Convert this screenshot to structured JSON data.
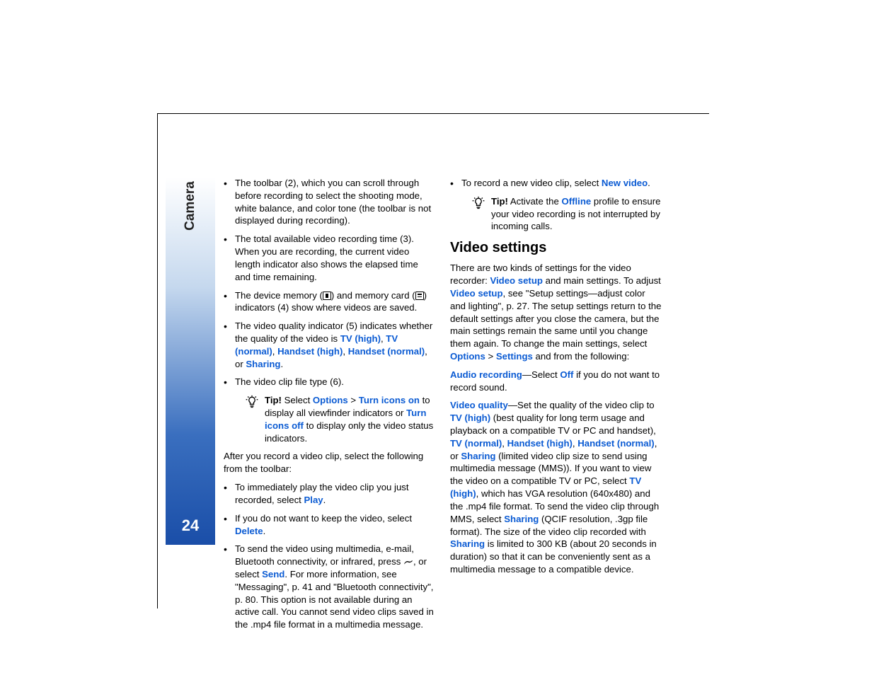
{
  "sidebar": {
    "section": "Camera",
    "page_number": "24"
  },
  "col1": {
    "bullets_top": [
      {
        "text": "The toolbar (2), which you can scroll through before recording to select the shooting mode, white balance, and color tone (the toolbar is not displayed during recording)."
      },
      {
        "text": "The total available video recording time (3). When you are recording, the current video length indicator also shows the elapsed time and time remaining."
      }
    ],
    "memory_pre": "The device memory (",
    "memory_mid": ") and memory card (",
    "memory_post": ") indicators (4) show where videos are saved.",
    "quality_pre": "The video quality indicator (5) indicates whether the quality of the video is ",
    "q_tvhigh": "TV (high)",
    "q_sep1": ", ",
    "q_tvnorm": "TV (normal)",
    "q_sep2": ", ",
    "q_hshigh": "Handset (high)",
    "q_sep3": ", ",
    "q_hsnorm": "Handset (normal)",
    "q_sep4": ", or ",
    "q_sharing": "Sharing",
    "q_end": ".",
    "filetype": "The video clip file type (6).",
    "tip1_tip": "Tip!",
    "tip1_a": " Select ",
    "tip1_options": "Options",
    "tip1_gt": " > ",
    "tip1_on": "Turn icons on",
    "tip1_b": " to display all viewfinder indicators or ",
    "tip1_off": "Turn icons off",
    "tip1_c": " to display only the video status indicators.",
    "after_record": "After you record a video clip, select the following from the toolbar:",
    "play_pre": "To immediately play the video clip you just recorded, select ",
    "play": "Play",
    "play_post": ".",
    "delete_pre": "If you do not want to keep the video, select ",
    "delete": "Delete",
    "delete_post": ".",
    "send_pre": "To send the video using multimedia, e-mail, Bluetooth connectivity, or infrared, press ",
    "send_mid": ", or select ",
    "send": "Send",
    "send_post": ". For more information, see \"Messaging\", p. 41 and \"Bluetooth connectivity\", p. 80. This option is not available during an active call. You cannot send video clips saved in the .mp4 file format in a multimedia message."
  },
  "col2": {
    "newvid_pre": "To record a new video clip, select ",
    "newvid": "New video",
    "newvid_post": ".",
    "tip2_tip": "Tip!",
    "tip2_a": " Activate the ",
    "tip2_offline": "Offline",
    "tip2_b": " profile to ensure your video recording is not interrupted by incoming calls.",
    "heading": "Video settings",
    "p1_a": "There are two kinds of settings for the video recorder: ",
    "p1_vs1": "Video setup",
    "p1_b": " and main settings. To adjust ",
    "p1_vs2": "Video setup",
    "p1_c": ", see \"Setup settings—adjust color and lighting\", p. 27. The setup settings return to the default settings after you close the camera, but the main settings remain the same until you change them again. To change the main settings, select ",
    "p1_options": "Options",
    "p1_gt": " > ",
    "p1_settings": "Settings",
    "p1_d": " and from the following:",
    "audio_label": "Audio recording",
    "audio_a": "—Select ",
    "audio_off": "Off",
    "audio_b": " if you do not want to record sound.",
    "vq_label": "Video quality",
    "vq_a": "—Set the quality of the video clip to ",
    "vq_tvhigh1": "TV (high)",
    "vq_b": " (best quality for long term usage and playback on a compatible TV or PC and handset), ",
    "vq_tvnorm": "TV (normal)",
    "vq_s1": ", ",
    "vq_hshigh": "Handset (high)",
    "vq_s2": ", ",
    "vq_hsnorm": "Handset (normal)",
    "vq_s3": ", or ",
    "vq_sharing1": "Sharing",
    "vq_c": " (limited video clip size to send using multimedia message (MMS)). If you want to view the video on a compatible TV or PC, select ",
    "vq_tvhigh2": "TV (high)",
    "vq_d": ", which has VGA resolution (640x480) and the .mp4 file format. To send the video clip through MMS, select ",
    "vq_sharing2": "Sharing",
    "vq_e": " (QCIF resolution, .3gp file format). The size of the video clip recorded with ",
    "vq_sharing3": "Sharing",
    "vq_f": " is limited to 300 KB (about 20 seconds in duration) so that it can be conveniently sent as a multimedia message to a compatible device."
  }
}
